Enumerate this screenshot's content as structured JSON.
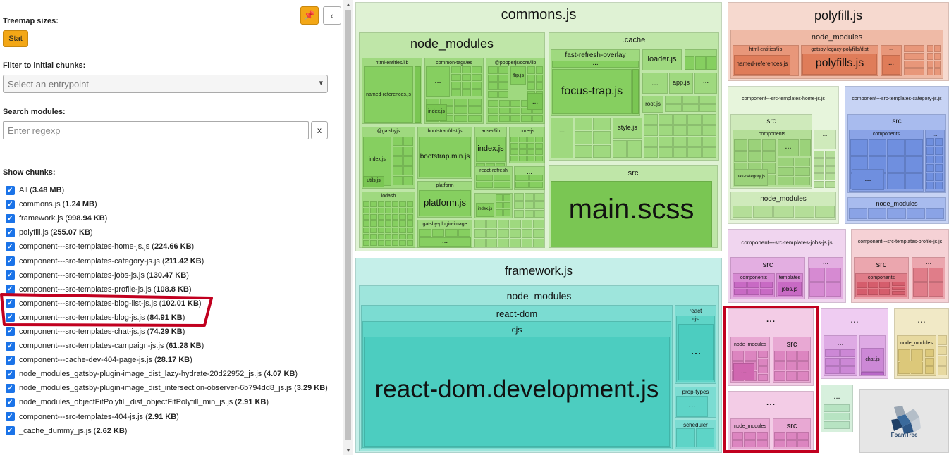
{
  "sidebar": {
    "treemap_sizes_label": "Treemap sizes:",
    "stat_button": "Stat",
    "filter_label": "Filter to initial chunks:",
    "entrypoint_placeholder": "Select an entrypoint",
    "search_label": "Search modules:",
    "search_placeholder": "Enter regexp",
    "clear_button": "x",
    "show_chunks_label": "Show chunks:",
    "chunks": [
      {
        "name": "All",
        "size": "3.48 MB"
      },
      {
        "name": "commons.js",
        "size": "1.24 MB"
      },
      {
        "name": "framework.js",
        "size": "998.94 KB"
      },
      {
        "name": "polyfill.js",
        "size": "255.07 KB"
      },
      {
        "name": "component---src-templates-home-js.js",
        "size": "224.66 KB"
      },
      {
        "name": "component---src-templates-category-js.js",
        "size": "211.42 KB"
      },
      {
        "name": "component---src-templates-jobs-js.js",
        "size": "130.47 KB"
      },
      {
        "name": "component---src-templates-profile-js.js",
        "size": "108.8 KB"
      },
      {
        "name": "component---src-templates-blog-list-js.js",
        "size": "102.01 KB"
      },
      {
        "name": "component---src-templates-blog-js.js",
        "size": "84.91 KB"
      },
      {
        "name": "component---src-templates-chat-js.js",
        "size": "74.29 KB"
      },
      {
        "name": "component---src-templates-campaign-js.js",
        "size": "61.28 KB"
      },
      {
        "name": "component---cache-dev-404-page-js.js",
        "size": "28.17 KB"
      },
      {
        "name": "node_modules_gatsby-plugin-image_dist_lazy-hydrate-20d22952_js.js",
        "size": "4.07 KB"
      },
      {
        "name": "node_modules_gatsby-plugin-image_dist_intersection-observer-6b794dd8_js.js",
        "size": "3.29 KB"
      },
      {
        "name": "node_modules_objectFitPolyfill_dist_objectFitPolyfill_min_js.js",
        "size": "2.91 KB"
      },
      {
        "name": "component---src-templates-404-js.js",
        "size": "2.91 KB"
      },
      {
        "name": "_cache_dummy_js.js",
        "size": "2.62 KB"
      }
    ]
  },
  "treemap": {
    "commons": "commons.js",
    "commons_node_modules": "node_modules",
    "html_entities": "html-entities/lib",
    "named_references": "named-references.js",
    "common_tags": "common-tags/es",
    "index_js": "index.js",
    "popperjs": "@popperjs/core/lib",
    "flip_js": "flip.js",
    "gatsbyjs": "@gatsbyjs",
    "utils_js": "utils.js",
    "bootstrap_dist": "bootstrap/dist/js",
    "bootstrap_min": "bootstrap.min.js",
    "anser_lib": "anser/lib",
    "core_js": "core-js",
    "react_refresh": "react-refresh",
    "lodash": "lodash",
    "platform": "platform",
    "platform_js": "platform.js",
    "gatsby_plugin_image": "gatsby-plugin-image",
    "cache": ".cache",
    "fast_refresh_overlay": "fast-refresh-overlay",
    "focus_trap": "focus-trap.js",
    "loader_js": "loader.js",
    "app_js": "app.js",
    "root_js": "root.js",
    "style_js": "style.js",
    "src": "src",
    "main_scss": "main.scss",
    "framework": "framework.js",
    "framework_node_modules": "node_modules",
    "react_dom": "react-dom",
    "cjs": "cjs",
    "react_dom_dev": "react-dom.development.js",
    "react": "react",
    "prop_types": "prop-types",
    "scheduler": "scheduler",
    "polyfill": "polyfill.js",
    "polyfill_node_modules": "node_modules",
    "polyfills_js": "polyfills.js",
    "gatsby_legacy_polyfills": "gatsby-legacy-polyfills/dist",
    "home_chunk": "component---src-templates-home-js.js",
    "components": "components",
    "nav_category": "nav-category.js",
    "category_chunk": "component---src-templates-category-js.js",
    "jobs_chunk": "component---src-templates-jobs-js.js",
    "templates": "templates",
    "jobs_js": "jobs.js",
    "profile_chunk": "component---src-templates-profile-js.js",
    "chat_js": "chat.js",
    "ellipsis": "...",
    "foamtree": "FoamTree"
  },
  "colors": {
    "accent": "#f3a716",
    "highlight": "#c1001f",
    "checkbox": "#1a73e8"
  }
}
